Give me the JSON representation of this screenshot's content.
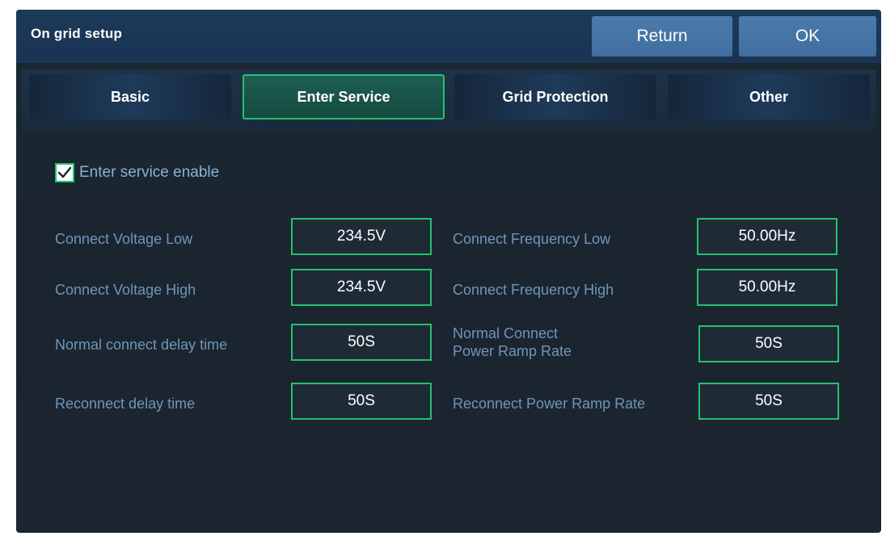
{
  "window": {
    "title": "On grid setup",
    "return_label": "Return",
    "ok_label": "OK"
  },
  "tabs": [
    {
      "label": "Basic",
      "active": false
    },
    {
      "label": "Enter Service",
      "active": true
    },
    {
      "label": "Grid Protection",
      "active": false
    },
    {
      "label": "Other",
      "active": false
    }
  ],
  "enter_service": {
    "enable_label": "Enter service enable",
    "enable_checked": true,
    "fields": {
      "connect_voltage_low": {
        "label": "Connect Voltage Low",
        "value": "234.5V"
      },
      "connect_voltage_high": {
        "label": "Connect Voltage High",
        "value": "234.5V"
      },
      "normal_connect_delay_time": {
        "label": "Normal connect delay time",
        "value": "50S"
      },
      "reconnect_delay_time": {
        "label": "Reconnect delay time",
        "value": "50S"
      },
      "connect_frequency_low": {
        "label": "Connect Frequency Low",
        "value": "50.00Hz"
      },
      "connect_frequency_high": {
        "label": "Connect Frequency High",
        "value": "50.00Hz"
      },
      "normal_connect_power_ramp_rate": {
        "label_line1": "Normal Connect",
        "label_line2": "Power Ramp Rate",
        "value": "50S"
      },
      "reconnect_power_ramp_rate": {
        "label": "Reconnect Power Ramp Rate",
        "value": "50S"
      }
    }
  },
  "colors": {
    "accent_green": "#23c26c",
    "label_blue": "#6f95bb",
    "button_blue": "#4c7bab",
    "titlebar": "#1c3a59"
  },
  "icons": {
    "checkbox": "checkmark-icon"
  }
}
